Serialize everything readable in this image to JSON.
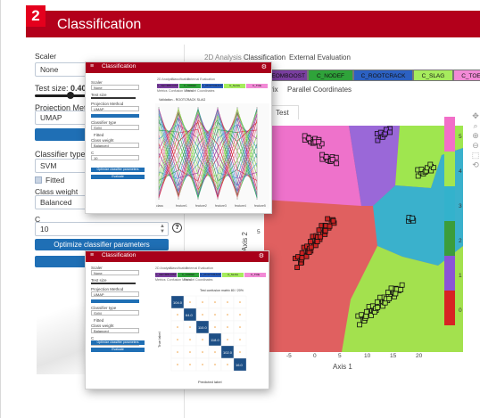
{
  "header": {
    "number": "2",
    "title": "Classification"
  },
  "sidebar": {
    "scaler_label": "Scaler",
    "scaler_value": "None",
    "test_size_label": "Test size:",
    "test_size_value": "0.40",
    "test_size_fraction": 0.4,
    "projection_label": "Projection Method",
    "projection_value": "UMAP",
    "classifier_label": "Classifier type",
    "classifier_value": "SVM",
    "fitted_label": "Fitted",
    "class_weight_label": "Class weight",
    "class_weight_value": "Balanced",
    "c_label": "C",
    "c_value": "10",
    "help_icon": "?",
    "optimize_label": "Optimize classifier parameters"
  },
  "main": {
    "tabs": [
      "2D Analysis",
      "Classification",
      "External Evaluation"
    ],
    "class_chips": [
      {
        "label": "C_GEOMBOOST",
        "color": "#7a3fa0"
      },
      {
        "label": "C_NODEF",
        "color": "#2fa33a"
      },
      {
        "label": "C_ROOTCRACK",
        "color": "#2c61c2"
      },
      {
        "label": "C_SLAG",
        "color": "#a6ec5d"
      },
      {
        "label": "C_TOE",
        "color": "#f28ad6"
      }
    ],
    "subtabs": [
      "trix",
      "Parallel Coordinates"
    ],
    "test_tab": "Test",
    "xaxis_label": "Axis 1",
    "yaxis_label": "Axis 2",
    "x_ticks": [
      "-5",
      "0",
      "5",
      "10",
      "15",
      "20"
    ],
    "y_ticks": [
      "5"
    ],
    "colorbar": [
      {
        "value": "5",
        "color": "#f26fc8"
      },
      {
        "value": "4",
        "color": "#a3e650"
      },
      {
        "value": "3",
        "color": "#33b2cc"
      },
      {
        "value": "2",
        "color": "#3b9d3b"
      },
      {
        "value": "1",
        "color": "#8b54d6"
      },
      {
        "value": "0",
        "color": "#d72323"
      }
    ],
    "toolbar_icons": [
      "pan-icon",
      "zoom-icon",
      "zoom-in-icon",
      "zoom-out-icon",
      "autoscale-icon",
      "reset-icon"
    ]
  },
  "window_top": {
    "title": "Classification",
    "menu_glyph": "≡",
    "close_glyph": "⚙",
    "fields": [
      "Scaler",
      "None",
      "Test size",
      "Projection Method",
      "UMAP",
      "Classifier type",
      "SVM",
      "Fitted",
      "Class weight",
      "Balanced",
      "C",
      "10"
    ],
    "optimize": "Optimize classifier parameters",
    "evaluate": "Evaluate",
    "tabs": [
      "2D Analysis",
      "Classification",
      "External Evaluation"
    ],
    "subtabs": [
      "Metrics",
      "Confusion Matrix",
      "Parallel Coordinates"
    ],
    "chart_title": "Validation - ROOTCRACK SLAG",
    "axis_names": [
      "class",
      "feature1",
      "feature2",
      "feature3",
      "feature4",
      "feature5",
      "feature6"
    ]
  },
  "window_bottom": {
    "title": "Classification",
    "menu_glyph": "≡",
    "close_glyph": "⚙",
    "optimize": "Optimize classifier parameters",
    "evaluate": "Evaluate",
    "tabs": [
      "2D Analysis",
      "Classification",
      "External Evaluation"
    ],
    "subtabs": [
      "Metrics",
      "Confusion Matrix",
      "Parallel Coordinates"
    ],
    "matrix_title": "Test confusion matrix 80 / 20%",
    "xlabel": "Predicted label",
    "ylabel": "True label",
    "diag": [
      "104.0",
      "64.0",
      "110.0",
      "118.0",
      "102.0",
      "16.0"
    ]
  }
}
